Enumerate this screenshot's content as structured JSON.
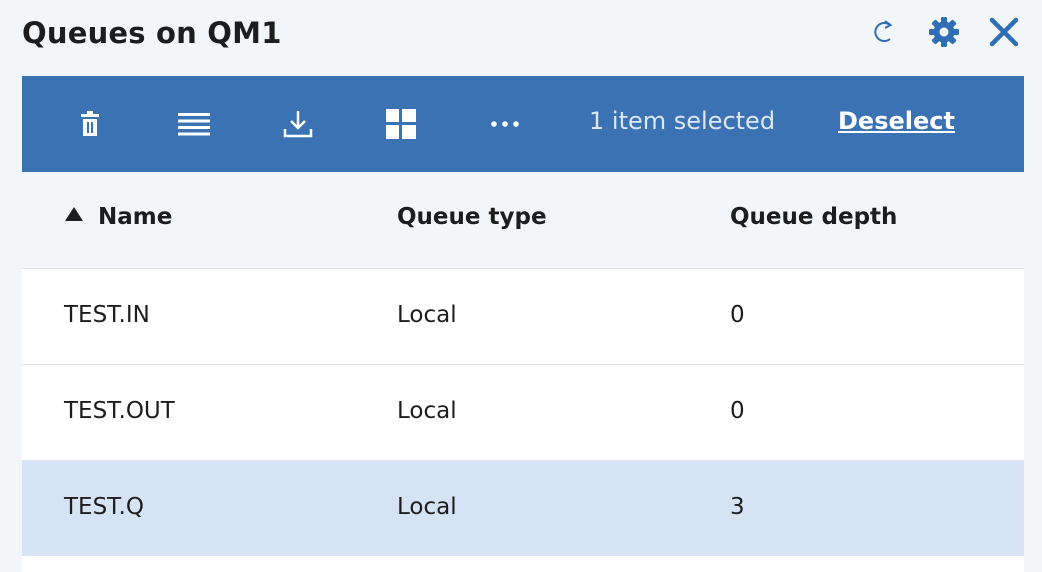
{
  "header": {
    "title": "Queues on QM1",
    "icons": [
      "refresh-icon",
      "settings-icon",
      "close-icon"
    ]
  },
  "toolbar": {
    "icons": [
      "delete-icon",
      "list-icon",
      "download-icon",
      "grid-icon",
      "more-icon"
    ],
    "selected_text": "1 item selected",
    "deselect_label": "Deselect"
  },
  "table": {
    "sort": {
      "column": "Name",
      "direction": "ascending"
    },
    "columns": [
      "Name",
      "Queue type",
      "Queue depth"
    ],
    "rows": [
      {
        "name": "TEST.IN",
        "type": "Local",
        "depth": "0",
        "selected": false
      },
      {
        "name": "TEST.OUT",
        "type": "Local",
        "depth": "0",
        "selected": false
      },
      {
        "name": "TEST.Q",
        "type": "Local",
        "depth": "3",
        "selected": true
      }
    ]
  },
  "colors": {
    "toolbar": "#3b72b3",
    "accent": "#2f6db5",
    "selected_row": "#d5e3f4",
    "page_background": "#f3f6f9"
  }
}
